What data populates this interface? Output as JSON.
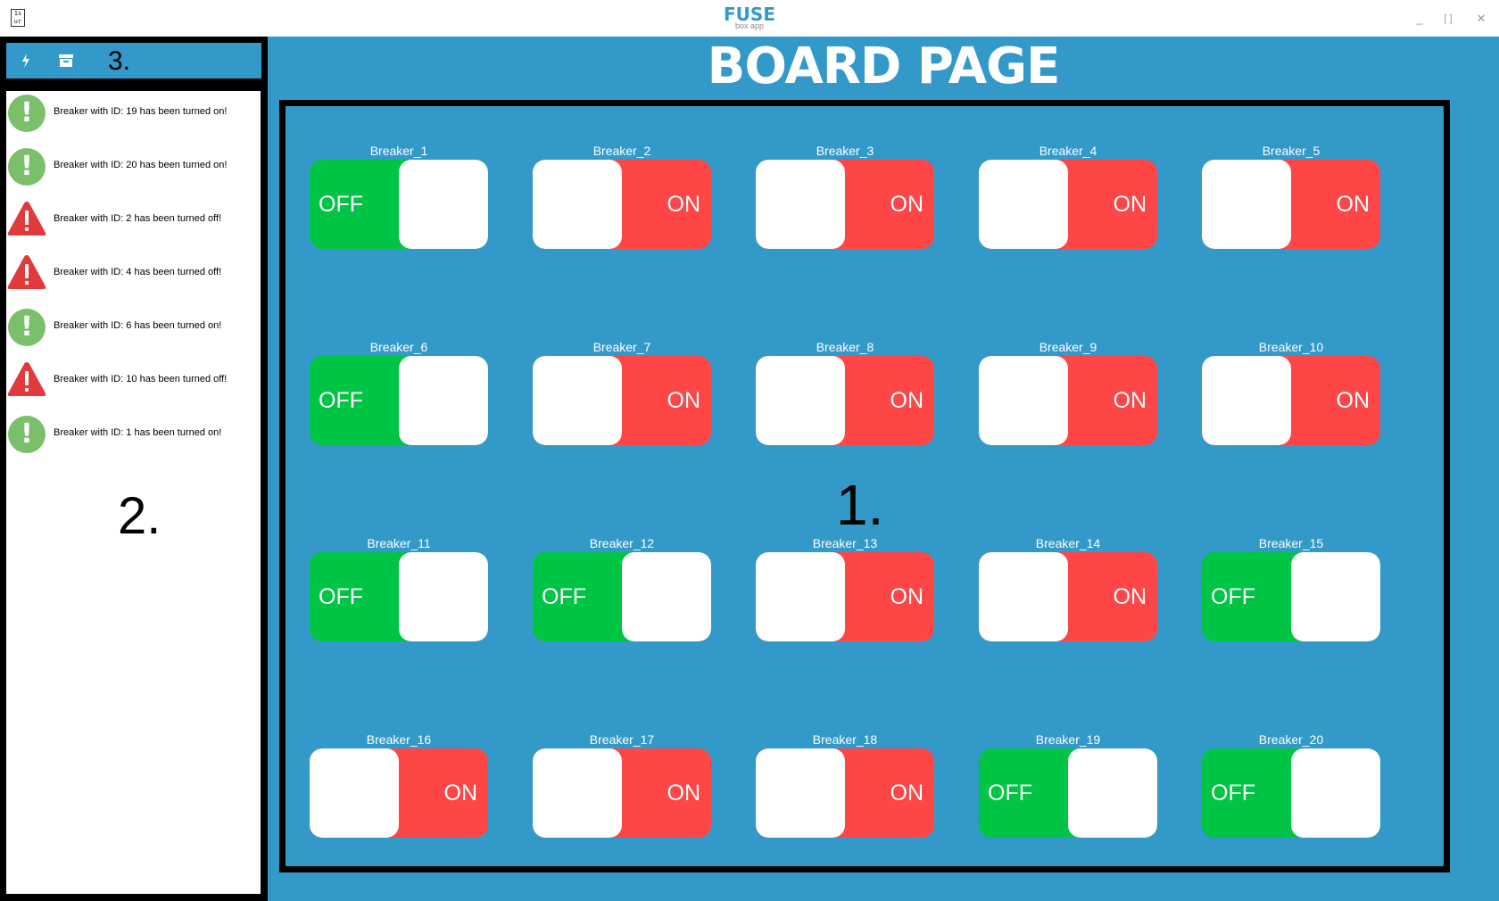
{
  "window": {
    "app_icon_text": "1s ur",
    "brand_title": "FUSE",
    "brand_subtitle": "box app",
    "minimize_glyph": "_",
    "maximize_glyph": "[ ]",
    "close_glyph": "✕"
  },
  "sidebar": {
    "toolbar": {
      "icons": [
        "lightning-icon",
        "archive-icon"
      ],
      "annotation": "3."
    },
    "log": [
      {
        "type": "on",
        "icon": "success-icon",
        "text": "Breaker with ID: 19 has been turned on!"
      },
      {
        "type": "on",
        "icon": "success-icon",
        "text": "Breaker with ID: 20 has been turned on!"
      },
      {
        "type": "off",
        "icon": "warning-icon",
        "text": "Breaker with ID: 2 has been turned off!"
      },
      {
        "type": "off",
        "icon": "warning-icon",
        "text": "Breaker with ID: 4 has been turned off!"
      },
      {
        "type": "on",
        "icon": "success-icon",
        "text": "Breaker with ID: 6 has been turned on!"
      },
      {
        "type": "off",
        "icon": "warning-icon",
        "text": "Breaker with ID: 10 has been turned off!"
      },
      {
        "type": "on",
        "icon": "success-icon",
        "text": "Breaker with ID: 1 has been turned on!"
      }
    ],
    "annotation": "2."
  },
  "main": {
    "title": "BOARD PAGE",
    "annotation": "1.",
    "colors": {
      "off": "#00c544",
      "on": "#ff4646",
      "background": "#3399c8"
    },
    "breakers": [
      {
        "name": "Breaker_1",
        "state": "OFF"
      },
      {
        "name": "Breaker_2",
        "state": "ON"
      },
      {
        "name": "Breaker_3",
        "state": "ON"
      },
      {
        "name": "Breaker_4",
        "state": "ON"
      },
      {
        "name": "Breaker_5",
        "state": "ON"
      },
      {
        "name": "Breaker_6",
        "state": "OFF"
      },
      {
        "name": "Breaker_7",
        "state": "ON"
      },
      {
        "name": "Breaker_8",
        "state": "ON"
      },
      {
        "name": "Breaker_9",
        "state": "ON"
      },
      {
        "name": "Breaker_10",
        "state": "ON"
      },
      {
        "name": "Breaker_11",
        "state": "OFF"
      },
      {
        "name": "Breaker_12",
        "state": "OFF"
      },
      {
        "name": "Breaker_13",
        "state": "ON"
      },
      {
        "name": "Breaker_14",
        "state": "ON"
      },
      {
        "name": "Breaker_15",
        "state": "OFF"
      },
      {
        "name": "Breaker_16",
        "state": "ON"
      },
      {
        "name": "Breaker_17",
        "state": "ON"
      },
      {
        "name": "Breaker_18",
        "state": "ON"
      },
      {
        "name": "Breaker_19",
        "state": "OFF"
      },
      {
        "name": "Breaker_20",
        "state": "OFF"
      }
    ]
  }
}
